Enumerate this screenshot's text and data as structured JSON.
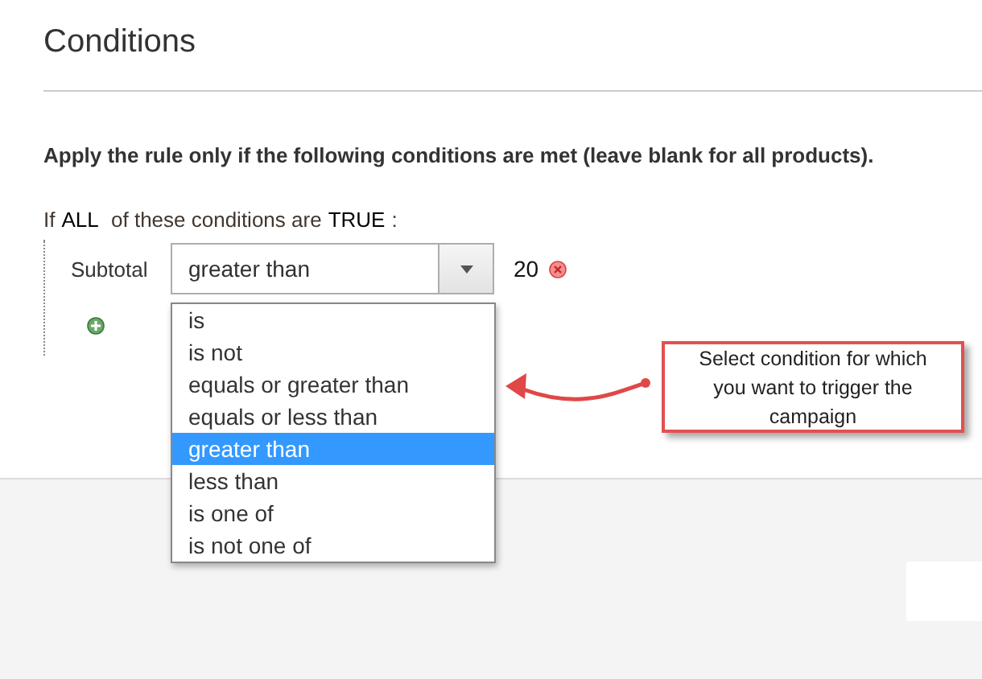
{
  "section": {
    "title": "Conditions"
  },
  "description": "Apply the rule only if the following conditions are met (leave blank for all products).",
  "rule_intro": {
    "prefix": "If",
    "aggregator": "ALL",
    "middle": "of these conditions are",
    "value": "TRUE",
    "suffix": ":"
  },
  "condition": {
    "attribute": "Subtotal",
    "operator": "greater than",
    "value": "20",
    "dropdown_open": true,
    "options": [
      {
        "label": "is",
        "selected": false
      },
      {
        "label": "is not",
        "selected": false
      },
      {
        "label": "equals or greater than",
        "selected": false
      },
      {
        "label": "equals or less than",
        "selected": false
      },
      {
        "label": "greater than",
        "selected": true
      },
      {
        "label": "less than",
        "selected": false
      },
      {
        "label": "is one of",
        "selected": false
      },
      {
        "label": "is not one of",
        "selected": false
      }
    ]
  },
  "callout": {
    "text": "Select condition for which you want to trigger the campaign"
  }
}
